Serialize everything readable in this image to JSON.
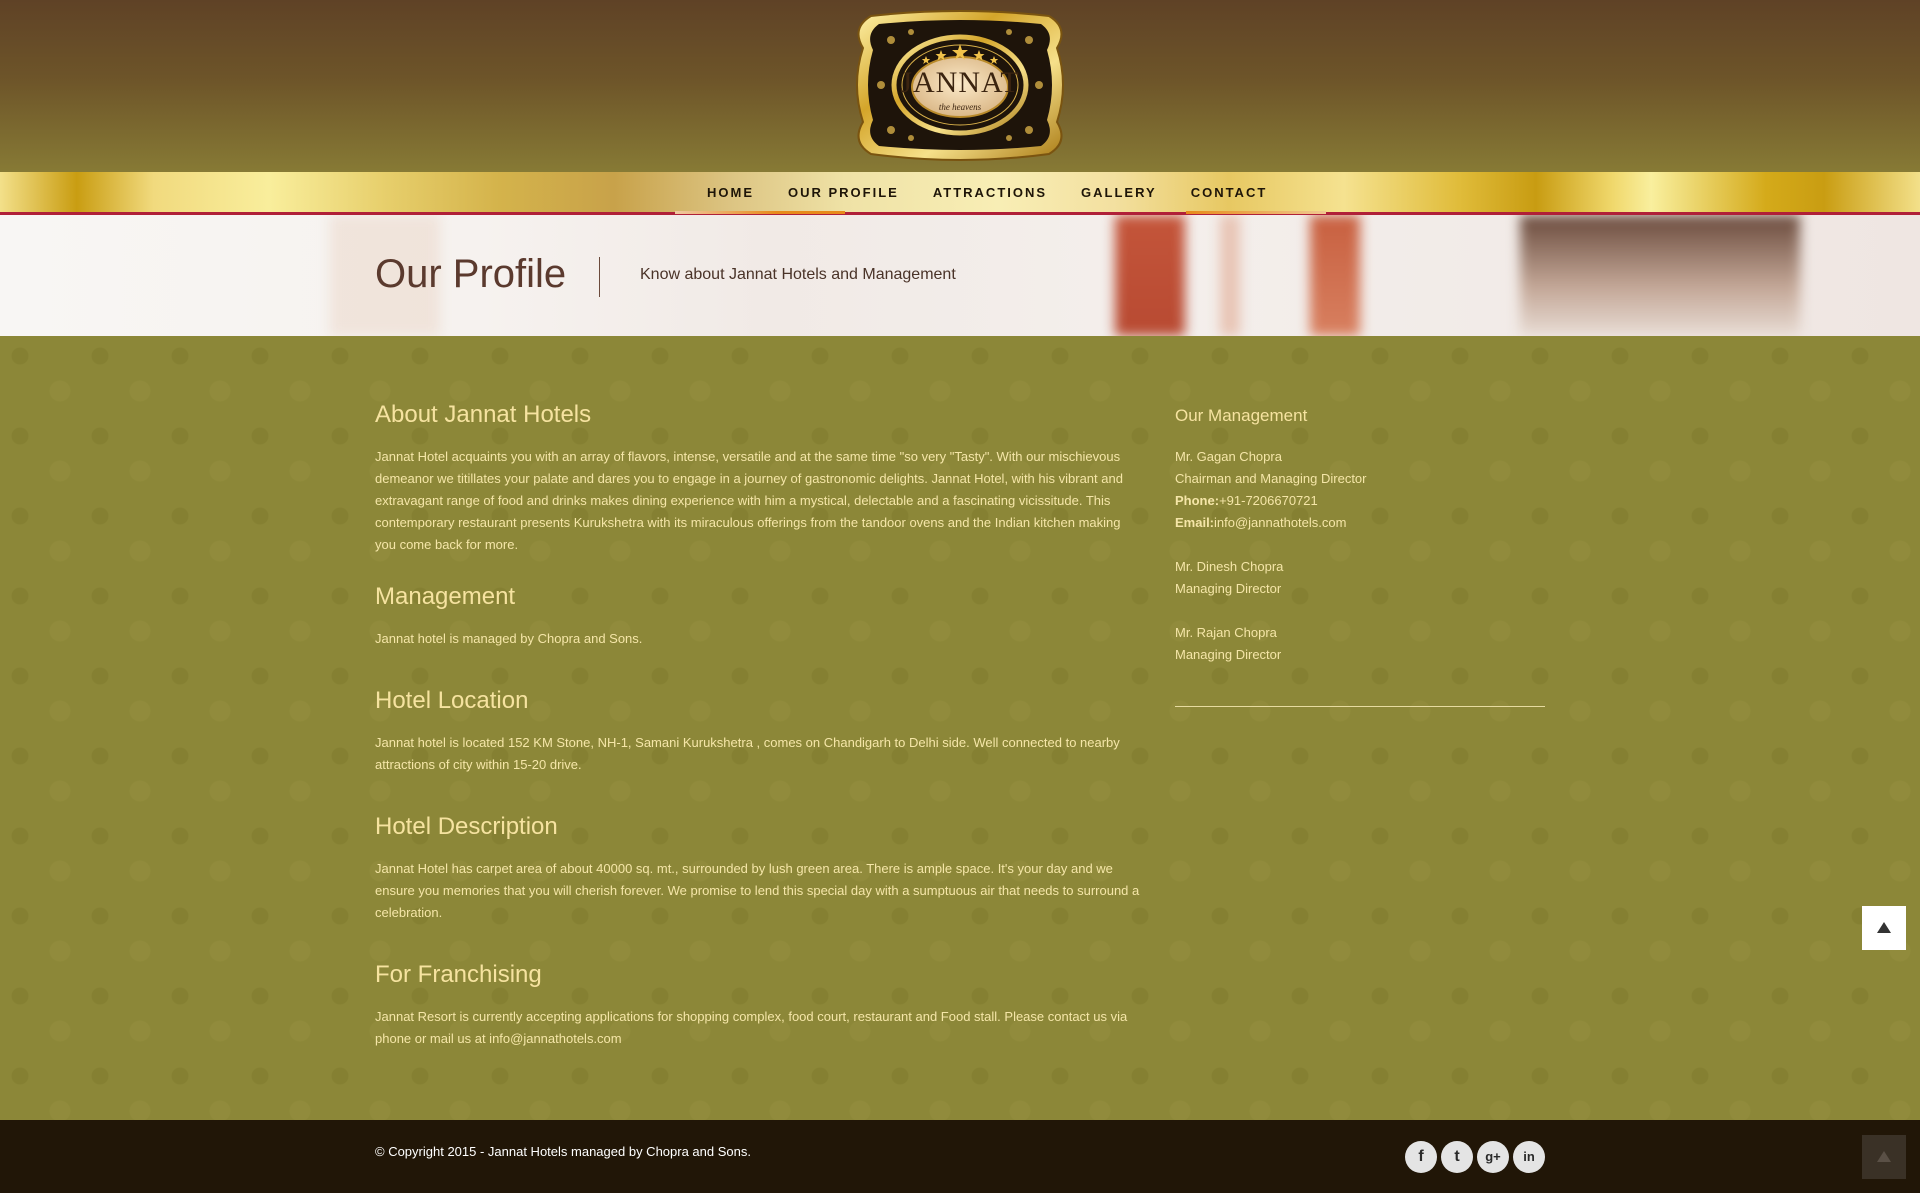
{
  "brand": {
    "name": "JANNAT",
    "tagline": "the heavens"
  },
  "nav": {
    "items": [
      {
        "label": "HOME"
      },
      {
        "label": "OUR PROFILE"
      },
      {
        "label": "ATTRACTIONS"
      },
      {
        "label": "GALLERY"
      },
      {
        "label": "CONTACT"
      }
    ],
    "active": "OUR PROFILE"
  },
  "banner": {
    "title": "Our Profile",
    "subtitle": "Know about Jannat Hotels and Management"
  },
  "sections": [
    {
      "title": "About Jannat Hotels",
      "body": "Jannat Hotel acquaints you with an array of flavors, intense, versatile and at the same time \"so very \"Tasty\". With our mischievous demeanor we titillates your palate and dares you to engage in a journey of gastronomic delights. Jannat Hotel, with his vibrant and extravagant range of food and drinks makes dining experience with him a mystical, delectable and a fascinating vicissitude. This contemporary restaurant presents Kurukshetra with its miraculous offerings from the tandoor ovens and the Indian kitchen making you come back for more."
    },
    {
      "title": "Management",
      "body": "Jannat hotel is managed by Chopra and Sons."
    },
    {
      "title": "Hotel Location",
      "body": "Jannat hotel is located 152 KM Stone, NH-1, Samani Kurukshetra , comes on Chandigarh to Delhi side. Well connected to nearby attractions of city within 15-20 drive."
    },
    {
      "title": "Hotel Description",
      "body": "Jannat Hotel has carpet area of about 40000 sq. mt., surrounded by lush green area. There is ample space. It's your day and we ensure you memories that you will cherish forever. We promise to lend this special day with a sumptuous air that needs to surround a celebration."
    },
    {
      "title": "For Franchising",
      "body": "Jannat Resort is currently accepting applications for shopping complex, food court, restaurant and Food stall. Please contact us via phone or mail us at info@jannathotels.com"
    }
  ],
  "management": {
    "title": "Our Management",
    "people": [
      {
        "name": "Mr. Gagan Chopra",
        "role": "Chairman and Managing Director",
        "phone_label": "Phone:",
        "phone": "+91-7206670721",
        "email_label": "Email:",
        "email": "info@jannathotels.com"
      },
      {
        "name": "Mr. Dinesh Chopra",
        "role": "Managing Director"
      },
      {
        "name": "Mr. Rajan Chopra",
        "role": "Managing Director"
      }
    ]
  },
  "footer": {
    "copyright": "© Copyright 2015 - Jannat Hotels managed by Chopra and Sons.",
    "social": [
      {
        "icon": "facebook-icon",
        "glyph": "f"
      },
      {
        "icon": "twitter-icon",
        "glyph": "t"
      },
      {
        "icon": "google-plus-icon",
        "glyph": "g+"
      },
      {
        "icon": "linkedin-icon",
        "glyph": "in"
      }
    ]
  },
  "colors": {
    "accent_gold": "#c99d12",
    "nav_underline_orange": "#e88a1a",
    "nav_border_red": "#b02038",
    "main_background": "#8c8738",
    "heading_text": "#f6e3a0",
    "footer_background": "#211607"
  }
}
